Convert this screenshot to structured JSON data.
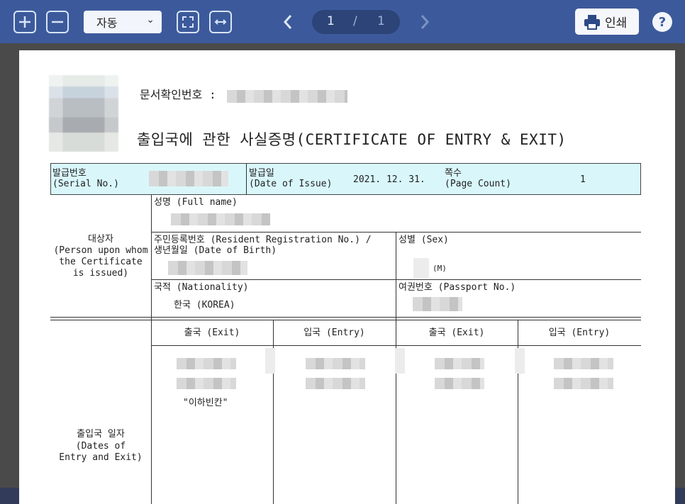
{
  "toolbar": {
    "zoom_value": "자동",
    "page_current": "1",
    "page_sep": "/",
    "page_total": "1",
    "print_label": "인쇄",
    "help_label": "?"
  },
  "document": {
    "doc_check_label": "문서확인번호 :",
    "title": "출입국에 관한 사실증명(CERTIFICATE OF ENTRY & EXIT)",
    "serial_label_ko": "발급번호",
    "serial_label_en": "(Serial No.)",
    "issue_label_ko": "발급일",
    "issue_label_en": "(Date of Issue)",
    "issue_date": "2021. 12. 31.",
    "pages_label_ko": "쪽수",
    "pages_label_en": "(Page Count)",
    "pages_value": "1",
    "subject_ko": "대상자",
    "subject_en1": "(Person upon whom",
    "subject_en2": "the Certificate",
    "subject_en3": "is issued)",
    "name_label": "성명 (Full name)",
    "resident_label1": "주민등록번호 (Resident Registration No.) /",
    "resident_label2": "생년월일 (Date of Birth)",
    "sex_label": "성별 (Sex)",
    "sex_value": "(M)",
    "nationality_label": "국적 (Nationality)",
    "nationality_value": "한국 (KOREA)",
    "passport_label": "여권번호 (Passport No.)",
    "dates_ko": "출입국 일자",
    "dates_en1": "(Dates of",
    "dates_en2": "Entry and Exit)",
    "col_exit_1": "출국 (Exit)",
    "col_entry_1": "입국 (Entry)",
    "col_exit_2": "출국 (Exit)",
    "col_entry_2": "입국 (Entry)",
    "below_blank": "\"이하빈칸\""
  },
  "colors": {
    "toolbar_bg": "#3c5a9b",
    "header_row_bg": "#d9f7fb"
  }
}
